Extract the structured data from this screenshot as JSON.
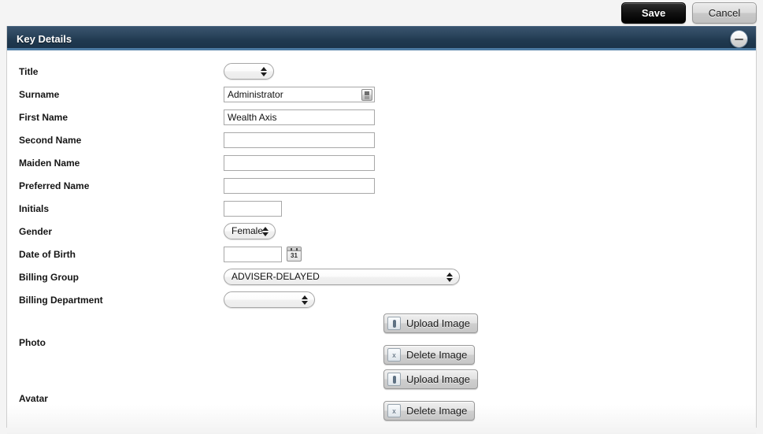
{
  "topbar": {
    "save_label": "Save",
    "cancel_label": "Cancel"
  },
  "panel": {
    "title": "Key Details",
    "collapse_icon": "minus-circle-icon"
  },
  "form": {
    "fields": [
      {
        "label": "Title",
        "type": "select",
        "value": ""
      },
      {
        "label": "Surname",
        "type": "text-lookup",
        "value": "Administrator"
      },
      {
        "label": "First Name",
        "type": "text",
        "value": "Wealth Axis"
      },
      {
        "label": "Second Name",
        "type": "text",
        "value": ""
      },
      {
        "label": "Maiden Name",
        "type": "text",
        "value": ""
      },
      {
        "label": "Preferred Name",
        "type": "text",
        "value": ""
      },
      {
        "label": "Initials",
        "type": "text-small",
        "value": ""
      },
      {
        "label": "Gender",
        "type": "select",
        "value": "Female"
      },
      {
        "label": "Date of Birth",
        "type": "date",
        "value": ""
      },
      {
        "label": "Billing Group",
        "type": "select",
        "value": "ADVISER-DELAYED"
      },
      {
        "label": "Billing Department",
        "type": "select",
        "value": ""
      }
    ],
    "calendar_day": "31",
    "photo": {
      "label": "Photo",
      "upload_label": "Upload Image",
      "delete_label": "Delete Image",
      "upload_icon": "attachment-icon",
      "delete_icon": "x-icon"
    },
    "avatar": {
      "label": "Avatar",
      "upload_label": "Upload Image",
      "delete_label": "Delete Image",
      "upload_icon": "attachment-icon",
      "delete_icon": "x-icon"
    }
  },
  "colors": {
    "header_dark": "#20394f",
    "header_accent": "#4d7ba3",
    "page_bg": "#f4f4f4",
    "save_bg": "#111111"
  }
}
